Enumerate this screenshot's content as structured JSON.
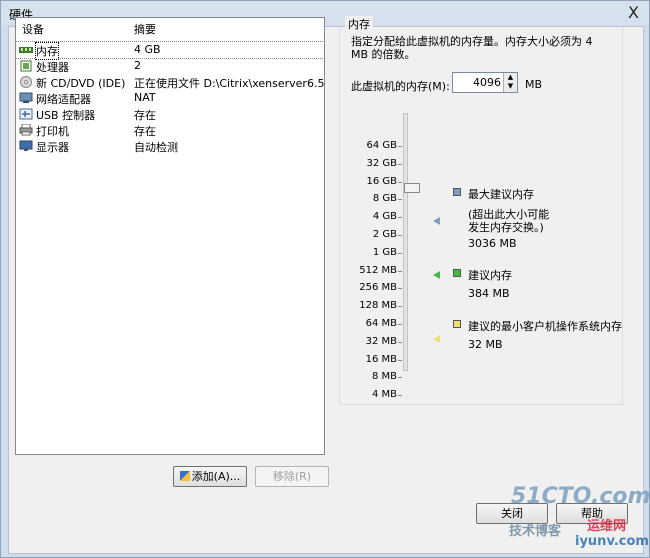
{
  "window": {
    "title": "硬件",
    "close_glyph": "X"
  },
  "device_list": {
    "col_device": "设备",
    "col_summary": "摘要",
    "rows": [
      {
        "name": "内存",
        "summary": "4 GB",
        "icon": "memory-icon"
      },
      {
        "name": "处理器",
        "summary": "2",
        "icon": "processor-icon"
      },
      {
        "name": "新 CD/DVD (IDE)",
        "summary": "正在使用文件 D:\\Citrix\\xenserver6.5...",
        "icon": "cd-dvd-icon"
      },
      {
        "name": "网络适配器",
        "summary": "NAT",
        "icon": "network-adapter-icon"
      },
      {
        "name": "USB 控制器",
        "summary": "存在",
        "icon": "usb-icon"
      },
      {
        "name": "打印机",
        "summary": "存在",
        "icon": "printer-icon"
      },
      {
        "name": "显示器",
        "summary": "自动检测",
        "icon": "display-icon"
      }
    ],
    "selected_index": 0
  },
  "buttons": {
    "add": "添加(A)...",
    "remove": "移除(R)",
    "ok": "关闭",
    "help": "帮助"
  },
  "memory": {
    "group_title": "内存",
    "description": "指定分配给此虚拟机的内存量。内存大小必须为 4 MB 的倍数。",
    "field_label": "此虚拟机的内存(M):",
    "value": "4096",
    "unit": "MB",
    "scale_labels": [
      "64 GB",
      "32 GB",
      "16 GB",
      "8 GB",
      "4 GB",
      "2 GB",
      "1 GB",
      "512 MB",
      "256 MB",
      "128 MB",
      "64 MB",
      "32 MB",
      "16 MB",
      "8 MB",
      "4 MB"
    ],
    "legend": {
      "max_title": "最大建议内存",
      "max_note_1": "(超出此大小可能",
      "max_note_2": "发生内存交换。)",
      "max_value": "3036 MB",
      "rec_title": "建议内存",
      "rec_value": "384 MB",
      "min_title": "建议的最小客户机操作系统内存",
      "min_value": "32 MB"
    },
    "colors": {
      "max": "#7d9ec0",
      "recommended": "#3fbf3f",
      "minimum": "#f2e26b"
    }
  },
  "watermark": {
    "line1": "51CTO.com",
    "line2": "技术博客",
    "line3": "运维网",
    "line4": "iyunv.com"
  }
}
